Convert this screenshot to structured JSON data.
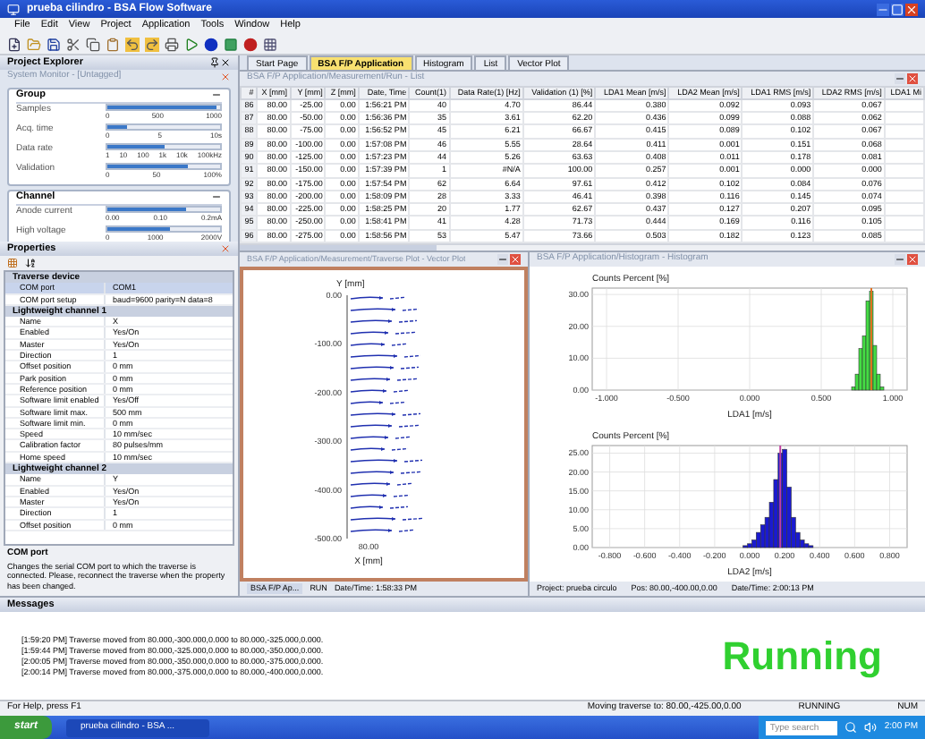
{
  "window": {
    "title": "prueba cilindro - BSA Flow Software"
  },
  "menu": [
    "File",
    "Edit",
    "View",
    "Project",
    "Application",
    "Tools",
    "Window",
    "Help"
  ],
  "project_explorer": {
    "title": "Project Explorer"
  },
  "system_monitor": {
    "title": "System Monitor - [Untagged]",
    "groups": [
      {
        "title": "Group",
        "meters": [
          {
            "label": "Samples",
            "level": 0.97,
            "ticks": [
              "0",
              "500",
              "1000"
            ]
          },
          {
            "label": "Acq. time",
            "level": 0.18,
            "ticks": [
              "0",
              "5",
              "10s"
            ]
          },
          {
            "label": "Data rate",
            "level": 0.5,
            "ticks": [
              "1",
              "10",
              "100",
              "1k",
              "10k",
              "100kHz"
            ]
          },
          {
            "label": "Validation",
            "level": 0.72,
            "ticks": [
              "0",
              "50",
              "100%"
            ]
          }
        ]
      },
      {
        "title": "Channel",
        "meters": [
          {
            "label": "Anode current",
            "level": 0.7,
            "ticks": [
              "0.00",
              "0.10",
              "0.2mA"
            ]
          },
          {
            "label": "High voltage",
            "level": 0.55,
            "ticks": [
              "0",
              "1000",
              "2000V"
            ]
          }
        ]
      }
    ]
  },
  "properties": {
    "title": "Properties",
    "rows": [
      {
        "kind": "section",
        "label": "Traverse device"
      },
      {
        "kind": "row",
        "label": "COM port",
        "value": "COM1",
        "selected": true
      },
      {
        "kind": "row",
        "label": "COM port setup",
        "value": "baud=9600 parity=N data=8",
        "selected": false
      },
      {
        "kind": "section",
        "label": "Lightweight channel 1"
      },
      {
        "kind": "row",
        "label": "Name",
        "value": "X",
        "selected": false
      },
      {
        "kind": "row",
        "label": "Enabled",
        "value": "Yes/On",
        "selected": false
      },
      {
        "kind": "row",
        "label": "Master",
        "value": "Yes/On",
        "selected": false
      },
      {
        "kind": "row",
        "label": "Direction",
        "value": "1",
        "selected": false
      },
      {
        "kind": "row",
        "label": "Offset position",
        "value": "0 mm",
        "selected": false
      },
      {
        "kind": "row",
        "label": "Park position",
        "value": "0 mm",
        "selected": false
      },
      {
        "kind": "row",
        "label": "Reference position",
        "value": "0 mm",
        "selected": false
      },
      {
        "kind": "row",
        "label": "Software limit enabled",
        "value": "Yes/Off",
        "selected": false
      },
      {
        "kind": "row",
        "label": "Software limit max.",
        "value": "500 mm",
        "selected": false
      },
      {
        "kind": "row",
        "label": "Software limit min.",
        "value": "0 mm",
        "selected": false
      },
      {
        "kind": "row",
        "label": "Speed",
        "value": "10 mm/sec",
        "selected": false
      },
      {
        "kind": "row",
        "label": "Calibration factor",
        "value": "80 pulses/mm",
        "selected": false
      },
      {
        "kind": "row",
        "label": "Home speed",
        "value": "10 mm/sec",
        "selected": false
      },
      {
        "kind": "section",
        "label": "Lightweight channel 2"
      },
      {
        "kind": "row",
        "label": "Name",
        "value": "Y",
        "selected": false
      },
      {
        "kind": "row",
        "label": "Enabled",
        "value": "Yes/On",
        "selected": false
      },
      {
        "kind": "row",
        "label": "Master",
        "value": "Yes/On",
        "selected": false
      },
      {
        "kind": "row",
        "label": "Direction",
        "value": "1",
        "selected": false
      },
      {
        "kind": "row",
        "label": "Offset position",
        "value": "0 mm",
        "selected": false
      }
    ],
    "help_title": "COM port",
    "help_text": "Changes the serial COM port to which the traverse is connected. Please, reconnect the traverse when the property has been changed."
  },
  "tabs": [
    {
      "label": "Start Page",
      "selected": false
    },
    {
      "label": "BSA F/P Application",
      "selected": true
    },
    {
      "label": "Histogram",
      "selected": false
    },
    {
      "label": "List",
      "selected": false
    },
    {
      "label": "Vector Plot",
      "selected": false
    }
  ],
  "list_window": {
    "title": "BSA F/P Application/Measurement/Run - List",
    "columns": [
      "#",
      "X [mm]",
      "Y [mm]",
      "Z [mm]",
      "Date, Time",
      "Count(1)",
      "Data Rate(1) [Hz]",
      "Validation (1) [%]",
      "LDA1 Mean [m/s]",
      "LDA2 Mean [m/s]",
      "LDA1 RMS [m/s]",
      "LDA2 RMS [m/s]",
      "LDA1 Mi"
    ],
    "rows": [
      [
        "86",
        "80.00",
        "-25.00",
        "0.00",
        "1:56:21 PM",
        "40",
        "4.70",
        "86.44",
        "0.380",
        "0.092",
        "0.093",
        "0.067"
      ],
      [
        "87",
        "80.00",
        "-50.00",
        "0.00",
        "1:56:36 PM",
        "35",
        "3.61",
        "62.20",
        "0.436",
        "0.099",
        "0.088",
        "0.062"
      ],
      [
        "88",
        "80.00",
        "-75.00",
        "0.00",
        "1:56:52 PM",
        "45",
        "6.21",
        "66.67",
        "0.415",
        "0.089",
        "0.102",
        "0.067"
      ],
      [
        "89",
        "80.00",
        "-100.00",
        "0.00",
        "1:57:08 PM",
        "46",
        "5.55",
        "28.64",
        "0.411",
        "0.001",
        "0.151",
        "0.068"
      ],
      [
        "90",
        "80.00",
        "-125.00",
        "0.00",
        "1:57:23 PM",
        "44",
        "5.26",
        "63.63",
        "0.408",
        "0.011",
        "0.178",
        "0.081"
      ],
      [
        "91",
        "80.00",
        "-150.00",
        "0.00",
        "1:57:39 PM",
        "1",
        "#N/A",
        "100.00",
        "0.257",
        "0.001",
        "0.000",
        "0.000"
      ],
      [
        "92",
        "80.00",
        "-175.00",
        "0.00",
        "1:57:54 PM",
        "62",
        "6.64",
        "97.61",
        "0.412",
        "0.102",
        "0.084",
        "0.076"
      ],
      [
        "93",
        "80.00",
        "-200.00",
        "0.00",
        "1:58:09 PM",
        "28",
        "3.33",
        "46.41",
        "0.398",
        "0.116",
        "0.145",
        "0.074"
      ],
      [
        "94",
        "80.00",
        "-225.00",
        "0.00",
        "1:58:25 PM",
        "20",
        "1.77",
        "62.67",
        "0.437",
        "0.127",
        "0.207",
        "0.095"
      ],
      [
        "95",
        "80.00",
        "-250.00",
        "0.00",
        "1:58:41 PM",
        "41",
        "4.28",
        "71.73",
        "0.444",
        "0.169",
        "0.116",
        "0.105"
      ],
      [
        "96",
        "80.00",
        "-275.00",
        "0.00",
        "1:58:56 PM",
        "53",
        "5.47",
        "73.66",
        "0.503",
        "0.182",
        "0.123",
        "0.085"
      ]
    ]
  },
  "vector_window": {
    "title": "BSA F/P Application/Measurement/Traverse Plot - Vector Plot",
    "y_label": "Y [mm]",
    "x_label": "X [mm]",
    "y_ticks": [
      "0.00",
      "-100.00",
      "-200.00",
      "-300.00",
      "-400.00",
      "-500.00"
    ],
    "x_tick": "80.00",
    "footer": {
      "tab": "BSA F/P Ap...",
      "run": "RUN",
      "time": "Date/Time: 1:58:33 PM"
    }
  },
  "histogram_window": {
    "title": "BSA F/P Application/Histogram - Histogram",
    "charts": [
      {
        "chart_data": {
          "type": "bar",
          "ylabel": "Counts Percent [%]",
          "xlabel": "LDA1 [m/s]",
          "x": [
            0.725,
            0.75,
            0.775,
            0.8,
            0.825,
            0.85,
            0.875,
            0.9,
            0.925
          ],
          "series": [
            {
              "color": "#44dd44",
              "values": [
                1,
                5,
                13,
                17,
                28,
                31,
                14,
                5,
                1
              ]
            }
          ],
          "xlim": [
            -1.1,
            1.1
          ],
          "ylim": [
            0,
            32
          ],
          "grid": true,
          "xticks": [
            {
              "value": -1,
              "label": "-1.000"
            },
            {
              "value": -0.5,
              "label": "-0.500"
            },
            {
              "value": 0,
              "label": "0.000"
            },
            {
              "value": 0.5,
              "label": "0.500"
            },
            {
              "value": 1,
              "label": "1.000"
            }
          ],
          "yticks": [
            {
              "value": 0,
              "label": "0.00"
            },
            {
              "value": 10,
              "label": "10.00"
            },
            {
              "value": 20,
              "label": "20.00"
            },
            {
              "value": 30,
              "label": "30.00"
            }
          ],
          "ref_lines": [
            {
              "axis": "x",
              "value": 0.85,
              "color": "#e07020"
            }
          ]
        }
      },
      {
        "chart_data": {
          "type": "bar",
          "ylabel": "Counts Percent [%]",
          "xlabel": "LDA2 [m/s]",
          "x": [
            -0.025,
            0,
            0.025,
            0.05,
            0.075,
            0.1,
            0.125,
            0.15,
            0.175,
            0.2,
            0.225,
            0.25,
            0.275,
            0.3,
            0.325,
            0.35
          ],
          "series": [
            {
              "color": "#1a1ad0",
              "values": [
                0.5,
                1,
                2,
                4,
                6,
                8,
                12,
                18,
                25,
                26,
                16,
                8,
                4,
                2,
                1,
                0.5
              ]
            }
          ],
          "xlim": [
            -0.9,
            0.9
          ],
          "ylim": [
            0,
            27
          ],
          "grid": true,
          "xticks": [
            {
              "value": -0.8,
              "label": "-0.800"
            },
            {
              "value": -0.6,
              "label": "-0.600"
            },
            {
              "value": -0.4,
              "label": "-0.400"
            },
            {
              "value": -0.2,
              "label": "-0.200"
            },
            {
              "value": 0,
              "label": "0.000"
            },
            {
              "value": 0.2,
              "label": "0.200"
            },
            {
              "value": 0.4,
              "label": "0.400"
            },
            {
              "value": 0.6,
              "label": "0.600"
            },
            {
              "value": 0.8,
              "label": "0.800"
            }
          ],
          "yticks": [
            {
              "value": 0,
              "label": "0.00"
            },
            {
              "value": 5,
              "label": "5.00"
            },
            {
              "value": 10,
              "label": "10.00"
            },
            {
              "value": 15,
              "label": "15.00"
            },
            {
              "value": 20,
              "label": "20.00"
            },
            {
              "value": 25,
              "label": "25.00"
            }
          ],
          "ref_lines": [
            {
              "axis": "x",
              "value": 0.175,
              "color": "#c040a0"
            }
          ]
        }
      }
    ],
    "footer": [
      "Project: prueba circulo",
      "Pos: 80.00,-400.00,0.00",
      "Date/Time: 2:00:13 PM"
    ]
  },
  "messages": {
    "title": "Messages",
    "lines": [
      "[1:59:20 PM] Traverse moved from 80.000,-300.000,0.000 to 80.000,-325.000,0.000.",
      "[1:59:44 PM] Traverse moved from 80.000,-325.000,0.000 to 80.000,-350.000,0.000.",
      "[2:00:05 PM] Traverse moved from 80.000,-350.000,0.000 to 80.000,-375.000,0.000.",
      "[2:00:14 PM] Traverse moved from 80.000,-375.000,0.000 to 80.000,-400.000,0.000."
    ]
  },
  "run_state": "Running",
  "status_bar": {
    "help": "For Help, press F1",
    "moving": "Moving traverse to: 80.00,-425.00,0.00",
    "state": "RUNNING",
    "num": "NUM"
  },
  "taskbar": {
    "start": "start",
    "task": "prueba cilindro - BSA ...",
    "search": {
      "placeholder": "Type search"
    },
    "clock": "2:00 PM"
  }
}
